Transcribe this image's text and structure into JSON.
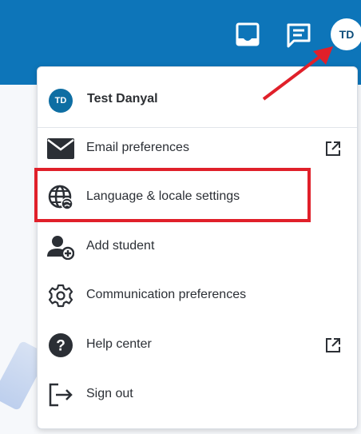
{
  "topbar": {
    "avatar_initials": "TD",
    "icons": [
      "inbox-icon",
      "message-icon"
    ]
  },
  "menu": {
    "user": {
      "initials": "TD",
      "name": "Test Danyal"
    },
    "items": [
      {
        "label": "Email preferences",
        "icon": "mail-icon",
        "external": true
      },
      {
        "label": "Language & locale settings",
        "icon": "globe-icon",
        "external": false,
        "highlighted": true
      },
      {
        "label": "Add student",
        "icon": "add-user-icon",
        "external": false
      },
      {
        "label": "Communication preferences",
        "icon": "gear-icon",
        "external": false
      },
      {
        "label": "Help center",
        "icon": "help-icon",
        "external": true
      },
      {
        "label": "Sign out",
        "icon": "sign-out-icon",
        "external": false
      }
    ]
  },
  "colors": {
    "topbar": "#0d75b9",
    "avatar_small": "#0e6ea3",
    "highlight": "#e0202a",
    "arrow": "#e0202a"
  }
}
